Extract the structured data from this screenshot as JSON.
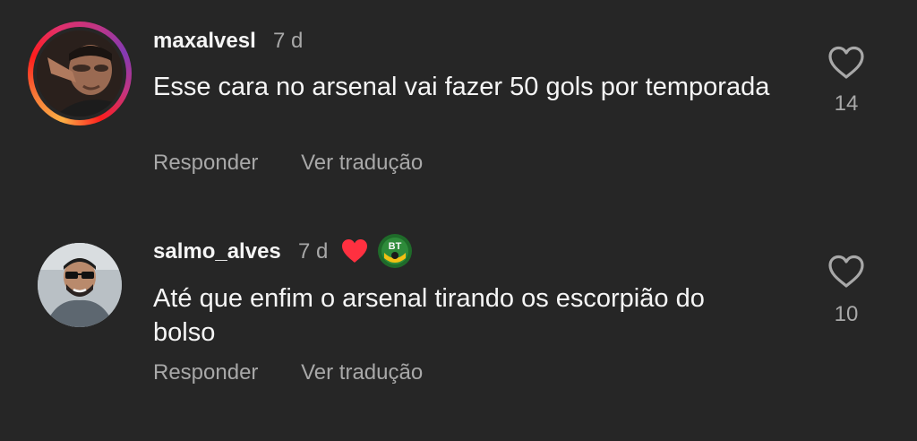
{
  "colors": {
    "background": "#262626",
    "primary_text": "#f5f5f5",
    "secondary_text": "#a8a8a8",
    "liked_heart": "#ff3040"
  },
  "comments": [
    {
      "username": "maxalvesl",
      "time": "7 d",
      "text": "Esse cara no arsenal vai fazer 50 gols por temporada",
      "reply_label": "Responder",
      "translate_label": "Ver tradução",
      "like_count": "14",
      "avatar": "avatar-with-story-ring",
      "like_icon": "heart-outline-icon"
    },
    {
      "username": "salmo_alves",
      "time": "7 d",
      "text": "Até que enfim o arsenal tirando os escorpião do bolso",
      "reply_label": "Responder",
      "translate_label": "Ver tradução",
      "like_count": "10",
      "avatar": "avatar",
      "creator_liked_icon": "red-heart-icon",
      "badge_icon": "br-badge-icon",
      "like_icon": "heart-outline-icon"
    }
  ]
}
